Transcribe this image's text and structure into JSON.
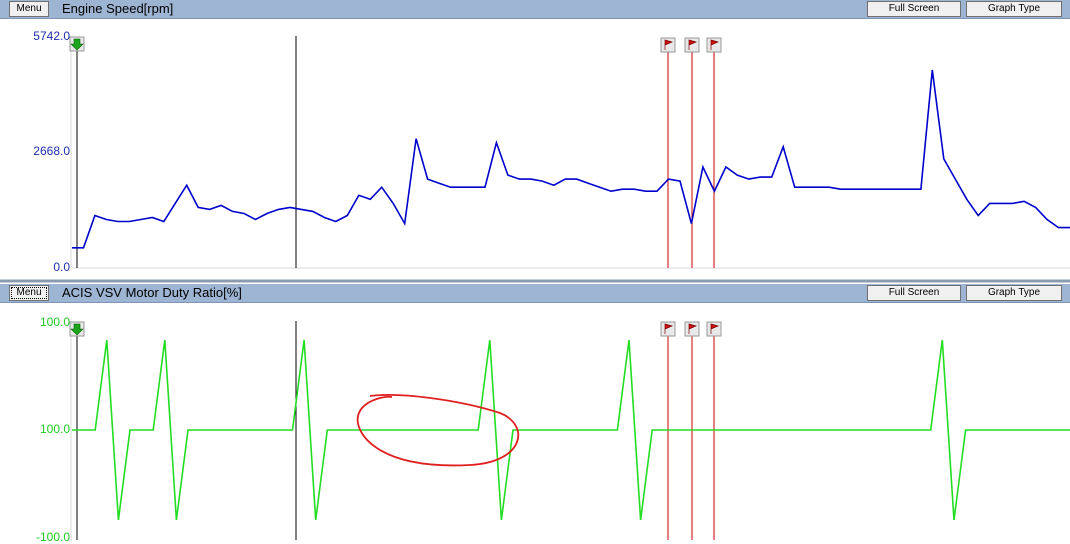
{
  "panels": [
    {
      "menu_label": "Menu",
      "title": "Engine Speed[rpm]",
      "full_screen_label": "Full Screen",
      "graph_type_label": "Graph Type",
      "y_labels": {
        "top": "5742.0",
        "mid": "2668.0",
        "bottom": "0.0"
      },
      "line_color": "#0000cc",
      "label_color": "#1f2fb0"
    },
    {
      "menu_label": "Menu",
      "title": "ACIS VSV Motor Duty Ratio[%]",
      "full_screen_label": "Full Screen",
      "graph_type_label": "Graph Type",
      "y_labels": {
        "top": "100.0",
        "mid": "100.0",
        "bottom": "-100.0"
      },
      "line_color": "#22dd22",
      "label_color": "#1fcc1f"
    }
  ],
  "markers": {
    "start_icon": "green-down-arrow-icon",
    "flag_icon": "red-flag-icon",
    "flag_count": 3,
    "cursor_color": "#000000",
    "flag_line_color": "#cc0000"
  },
  "annotation": {
    "shape": "hand-drawn-red-ellipse",
    "color": "#e02020"
  },
  "chart_data": [
    {
      "type": "line",
      "title": "Engine Speed[rpm]",
      "ylim": [
        0,
        5742
      ],
      "yticks": [
        0,
        2668,
        5742
      ],
      "series": [
        {
          "values": [
            500,
            500,
            1300,
            1200,
            1150,
            1150,
            1200,
            1250,
            1150,
            1600,
            2050,
            1500,
            1450,
            1550,
            1400,
            1350,
            1200,
            1350,
            1450,
            1500,
            1450,
            1400,
            1250,
            1150,
            1300,
            1800,
            1700,
            2000,
            1600,
            1100,
            3200,
            2200,
            2100,
            2000,
            2000,
            2000,
            2000,
            3100,
            2300,
            2200,
            2200,
            2150,
            2050,
            2200,
            2200,
            2100,
            2000,
            1900,
            1950,
            1950,
            1900,
            1900,
            2200,
            2150,
            1100,
            2500,
            1900,
            2500,
            2300,
            2200,
            2250,
            2250,
            3000,
            2000,
            2000,
            2000,
            2000,
            1950,
            1950,
            1950,
            1950,
            1950,
            1950,
            1950,
            1950,
            4900,
            2700,
            2200,
            1700,
            1300,
            1600,
            1600,
            1600,
            1650,
            1500,
            1200,
            1000,
            1000
          ]
        }
      ]
    },
    {
      "type": "line",
      "title": "ACIS VSV Motor Duty Ratio[%]",
      "ylim": [
        -100,
        100
      ],
      "series": [
        {
          "values": [
            0,
            0,
            0,
            100,
            -100,
            0,
            0,
            0,
            100,
            -100,
            0,
            0,
            0,
            0,
            0,
            0,
            0,
            0,
            0,
            0,
            100,
            -100,
            0,
            0,
            0,
            0,
            0,
            0,
            0,
            0,
            0,
            0,
            0,
            0,
            0,
            0,
            100,
            -100,
            0,
            0,
            0,
            0,
            0,
            0,
            0,
            0,
            0,
            0,
            100,
            -100,
            0,
            0,
            0,
            0,
            0,
            0,
            0,
            0,
            0,
            0,
            0,
            0,
            0,
            0,
            0,
            0,
            0,
            0,
            0,
            0,
            0,
            0,
            0,
            0,
            0,
            100,
            -100,
            0,
            0,
            0,
            0,
            0,
            0,
            0,
            0,
            0,
            0
          ]
        }
      ]
    }
  ]
}
